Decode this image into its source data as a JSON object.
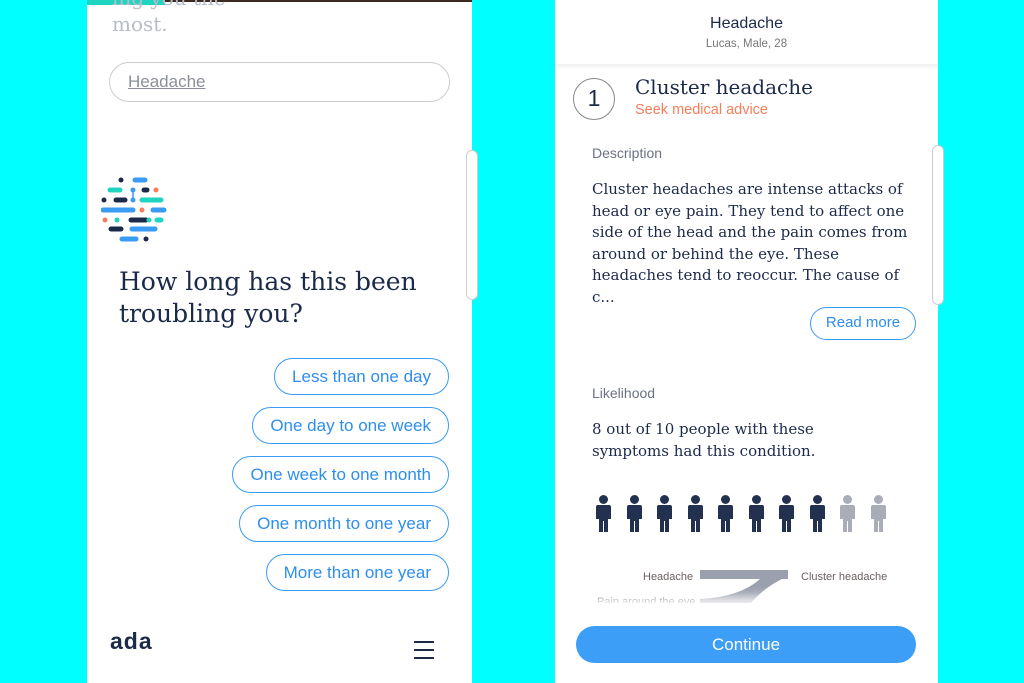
{
  "left": {
    "previous_text_line1": "ing you the",
    "previous_text_line2": "most.",
    "answer": "Headache",
    "question": "How long has this been troubling you?",
    "options": [
      "Less than one day",
      "One day to one week",
      "One week to one month",
      "One month to one year",
      "More than one year"
    ],
    "brand": "ada"
  },
  "right": {
    "header": {
      "title": "Headache",
      "subtitle": "Lucas, Male, 28"
    },
    "rank": "1",
    "condition": "Cluster headache",
    "advice": "Seek medical advice",
    "description_label": "Description",
    "description": "Cluster headaches are intense attacks of head or eye pain. They tend to affect one side of the head and the pain comes from around or behind the eye. These headaches tend to reoccur. The cause of c...",
    "read_more": "Read more",
    "likelihood_label": "Likelihood",
    "likelihood_text": "8 out of 10 people with these symptoms had this condition.",
    "likelihood": {
      "affected": 8,
      "total": 10
    },
    "flow": {
      "sources": [
        "Headache",
        "Pain around the eye"
      ],
      "target": "Cluster headache"
    },
    "continue": "Continue"
  },
  "colors": {
    "background": "#00ffff",
    "accent": "#3d9ef7",
    "advice": "#f47f5a",
    "navy": "#1c2a4a",
    "progress": "#1fd4c0"
  }
}
